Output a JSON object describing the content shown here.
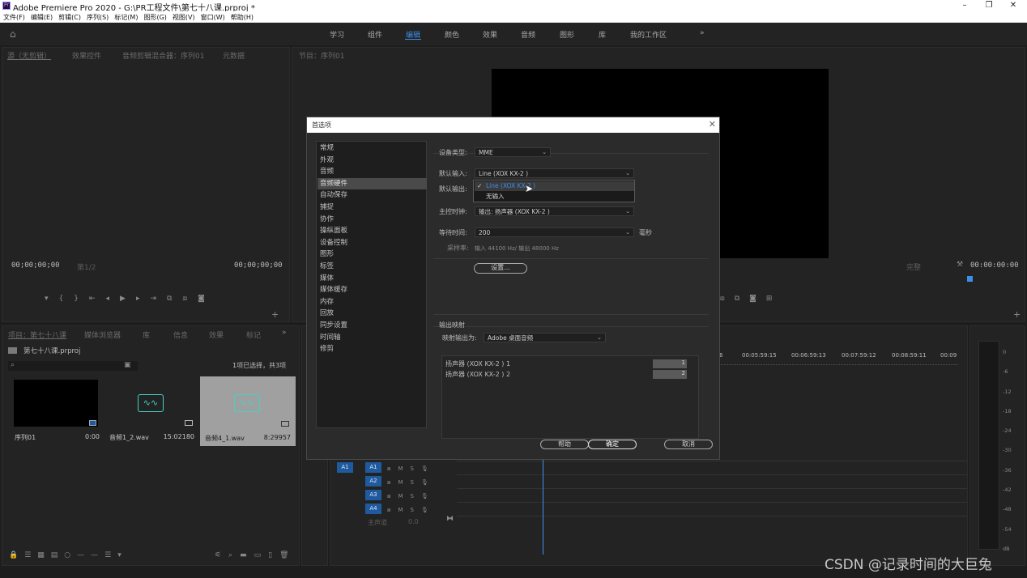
{
  "window": {
    "title": "Adobe Premiere Pro 2020 - G:\\PR工程文件\\第七十八课.prproj *"
  },
  "menu": [
    "文件(F)",
    "编辑(E)",
    "剪辑(C)",
    "序列(S)",
    "标记(M)",
    "图形(G)",
    "视图(V)",
    "窗口(W)",
    "帮助(H)"
  ],
  "workspaces": [
    "学习",
    "组件",
    "编辑",
    "颜色",
    "效果",
    "音频",
    "图形",
    "库",
    "我的工作区"
  ],
  "source_panel": {
    "tabs": [
      "源（无剪辑）",
      "效果控件",
      "音频剪辑混合器：序列01",
      "元数据"
    ],
    "timecode_left": "00;00;00;00",
    "timecode_right": "00;00;00;00",
    "zoom": "第1/2"
  },
  "program_panel": {
    "tab": "节目：序列01",
    "timecode": "00:00:00:00",
    "fit": "完整"
  },
  "project_panel": {
    "tabs": [
      "项目：第七十八课",
      "媒体浏览器",
      "库",
      "信息",
      "效果",
      "标记"
    ],
    "project_file": "第七十八课.prproj",
    "selection_info": "1项已选择，共3项",
    "items": [
      {
        "name": "序列01",
        "duration": "0:00"
      },
      {
        "name": "音频1_2.wav",
        "duration": "15:02180"
      },
      {
        "name": "音频4_1.wav",
        "duration": "8:29957"
      }
    ]
  },
  "timeline": {
    "ruler": [
      "6",
      "00:05:59:15",
      "00:06:59:13",
      "00:07:59:12",
      "00:08:59:11",
      "00:09"
    ],
    "tracks": [
      "A1",
      "A2",
      "A3",
      "A4"
    ],
    "source_track": "A1",
    "master_label": "主声道",
    "master_value": "0.0",
    "meter_ticks": [
      "0",
      "-6",
      "-12",
      "-18",
      "-24",
      "-30",
      "-36",
      "-42",
      "-48",
      "-54",
      "dB"
    ]
  },
  "dialog": {
    "title": "首选项",
    "sidebar": [
      "常规",
      "外观",
      "音频",
      "音频硬件",
      "自动保存",
      "捕捉",
      "协作",
      "操纵面板",
      "设备控制",
      "图形",
      "标签",
      "媒体",
      "媒体缓存",
      "内存",
      "回放",
      "同步设置",
      "时间轴",
      "修剪"
    ],
    "selected_index": 3,
    "device_class_label": "设备类型:",
    "device_class": "MME",
    "default_input_label": "默认输入:",
    "default_input": "Line (XOX KX-2 )",
    "default_output_label": "默认输出:",
    "master_clock_label": "主控时钟:",
    "master_clock": "输出: 扬声器 (XOX KX-2 )",
    "latency_label": "等待时间:",
    "latency": "200",
    "latency_unit": "毫秒",
    "sample_rate_label": "采样率:",
    "sample_rate": "输入 44100 Hz/ 输出 48000 Hz",
    "settings_button": "设置...",
    "output_mapping_title": "输出映射",
    "map_output_label": "映射输出为:",
    "map_output": "Adobe 桌面音频",
    "channels": [
      "扬声器 (XOX KX-2 ) 1",
      "扬声器 (XOX KX-2 ) 2"
    ],
    "channel_numbers": [
      "1",
      "2"
    ],
    "help_button": "帮助",
    "ok_button": "确定",
    "cancel_button": "取消",
    "popup_options": [
      "Line (XOX KX-2 )",
      "无输入"
    ]
  },
  "watermark": "CSDN @记录时间的大巨兔"
}
